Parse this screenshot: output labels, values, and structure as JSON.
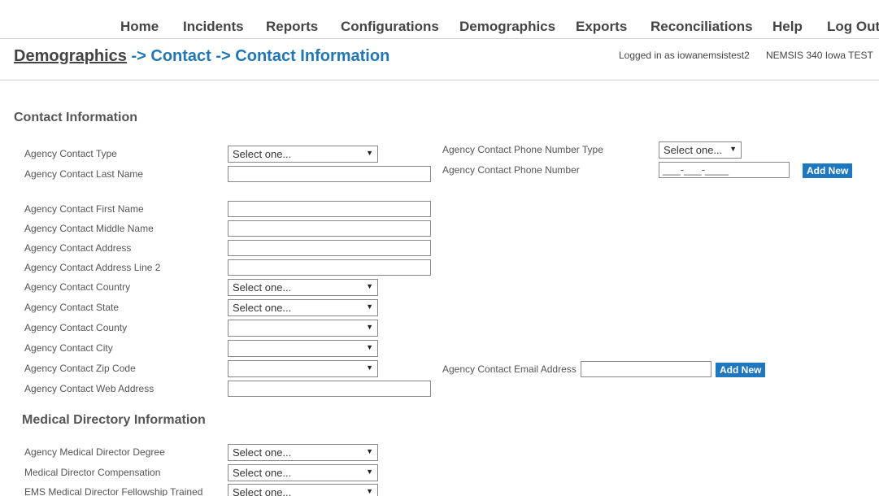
{
  "nav": {
    "home": "Home",
    "incidents": "Incidents",
    "reports": "Reports",
    "configurations": "Configurations",
    "demographics": "Demographics",
    "exports": "Exports",
    "reconciliations": "Reconciliations",
    "help": "Help",
    "logout": "Log Out"
  },
  "breadcrumb": {
    "root": "Demographics",
    "sep1": " -> ",
    "mid": "Contact",
    "sep2": " -> ",
    "current": "Contact Information"
  },
  "session": {
    "logged_in": "Logged in as iowanemsistest2",
    "environment": "NEMSIS 340 Iowa TEST"
  },
  "contact": {
    "title": "Contact Information",
    "type_label": "Agency Contact Type",
    "type_value": "Select one...",
    "last_name_label": "Agency Contact Last Name",
    "last_name_value": "",
    "first_name_label": "Agency Contact First Name",
    "first_name_value": "",
    "middle_name_label": "Agency Contact Middle Name",
    "middle_name_value": "",
    "address_label": "Agency Contact Address",
    "address_value": "",
    "address2_label": "Agency Contact Address Line 2",
    "address2_value": "",
    "country_label": "Agency Contact Country",
    "country_value": "Select one...",
    "state_label": "Agency Contact State",
    "state_value": "Select one...",
    "county_label": "Agency Contact County",
    "county_value": "",
    "city_label": "Agency Contact City",
    "city_value": "",
    "zip_label": "Agency Contact Zip Code",
    "zip_value": "",
    "web_label": "Agency Contact Web Address",
    "web_value": "",
    "phone_type_label": "Agency Contact Phone Number Type",
    "phone_type_value": "Select one...",
    "phone_label": "Agency Contact Phone Number",
    "phone_placeholder": "___-___-____",
    "phone_add": "Add New",
    "email_label": "Agency Contact Email Address",
    "email_value": "",
    "email_add": "Add New"
  },
  "medical": {
    "title": "Medical Directory Information",
    "degree_label": "Agency Medical Director Degree",
    "degree_value": "Select one...",
    "compensation_label": "Medical Director Compensation",
    "compensation_value": "Select one...",
    "fellowship_label": "EMS Medical Director Fellowship Trained",
    "fellowship_value": "Select one..."
  },
  "icons": {
    "dropdown": "▼"
  }
}
